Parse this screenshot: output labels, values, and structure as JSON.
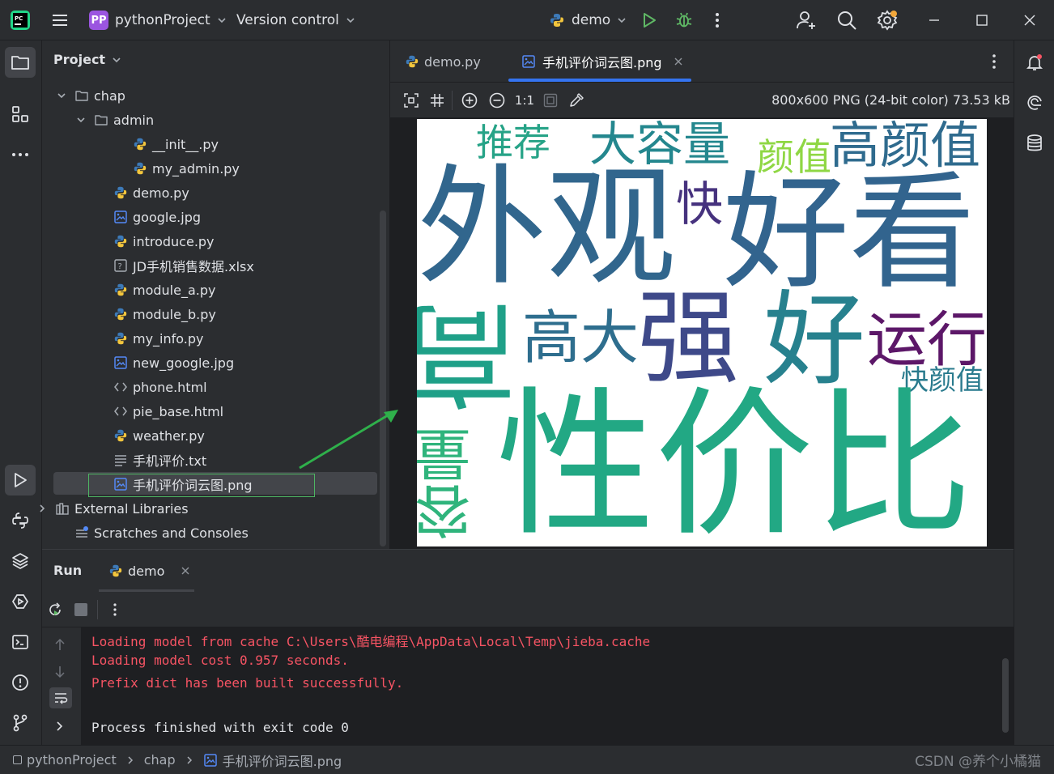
{
  "titlebar": {
    "project_badge": "PP",
    "project_name": "pythonProject",
    "vcs_label": "Version control",
    "run_config": "demo"
  },
  "project_panel": {
    "title": "Project",
    "tree": [
      {
        "label": "chap",
        "kind": "folder",
        "expanded": true
      },
      {
        "label": "admin",
        "kind": "folder",
        "expanded": true
      },
      {
        "label": "__init__.py",
        "kind": "python"
      },
      {
        "label": "my_admin.py",
        "kind": "python"
      },
      {
        "label": "demo.py",
        "kind": "python"
      },
      {
        "label": "google.jpg",
        "kind": "image"
      },
      {
        "label": "introduce.py",
        "kind": "python"
      },
      {
        "label": "JD手机销售数据.xlsx",
        "kind": "unknown"
      },
      {
        "label": "module_a.py",
        "kind": "python"
      },
      {
        "label": "module_b.py",
        "kind": "python"
      },
      {
        "label": "my_info.py",
        "kind": "python"
      },
      {
        "label": "new_google.jpg",
        "kind": "image"
      },
      {
        "label": "phone.html",
        "kind": "html"
      },
      {
        "label": "pie_base.html",
        "kind": "html"
      },
      {
        "label": "weather.py",
        "kind": "python"
      },
      {
        "label": "手机评价.txt",
        "kind": "text"
      },
      {
        "label": "手机评价词云图.png",
        "kind": "image",
        "selected": true
      },
      {
        "label": "External Libraries",
        "kind": "library"
      },
      {
        "label": "Scratches and Consoles",
        "kind": "scratch"
      }
    ]
  },
  "editor": {
    "tabs": [
      {
        "label": "demo.py",
        "active": false
      },
      {
        "label": "手机评价词云图.png",
        "active": true
      }
    ],
    "zoom_label": "1:1",
    "image_info": "800x600 PNG (24-bit color) 73.53 kB",
    "wordcloud": [
      {
        "text": "推荐",
        "color": "#26a387"
      },
      {
        "text": "大容量",
        "color": "#24878e"
      },
      {
        "text": "颜值",
        "color": "#8fd744"
      },
      {
        "text": "高颜值",
        "color": "#2f6b8e"
      },
      {
        "text": "外观",
        "color": "#31668d"
      },
      {
        "text": "快",
        "color": "#46327e"
      },
      {
        "text": "好看",
        "color": "#32648e"
      },
      {
        "text": "高大",
        "color": "#2e6e8e"
      },
      {
        "text": "强",
        "color": "#3e4989"
      },
      {
        "text": "好",
        "color": "#27818e"
      },
      {
        "text": "运行",
        "color": "#5c1768"
      },
      {
        "text": "快颜值",
        "color": "#2a7b8e"
      },
      {
        "text": "性价比",
        "color": "#22a884"
      },
      {
        "text": "容量",
        "color": "#2fb47c"
      },
      {
        "text": "高",
        "color": "#1fa088"
      }
    ]
  },
  "run_panel": {
    "title": "Run",
    "tab_label": "demo",
    "console": [
      {
        "text": "Loading model from cache C:\\Users\\酷电编程\\AppData\\Local\\Temp\\jieba.cache",
        "type": "error"
      },
      {
        "text": "Loading model cost 0.957 seconds.",
        "type": "error"
      },
      {
        "text": "Prefix dict has been built successfully.",
        "type": "error"
      },
      {
        "text": "",
        "type": "normal"
      },
      {
        "text": "Process finished with exit code 0",
        "type": "normal"
      }
    ]
  },
  "statusbar": {
    "breadcrumb": [
      "pythonProject",
      "chap",
      "手机评价词云图.png"
    ],
    "watermark": "CSDN @养个小橘猫"
  },
  "colors": {
    "accent": "#3574f0",
    "error_text": "#f75464",
    "run_green": "#5fb865",
    "annotation_arrow": "#2fb04b"
  }
}
